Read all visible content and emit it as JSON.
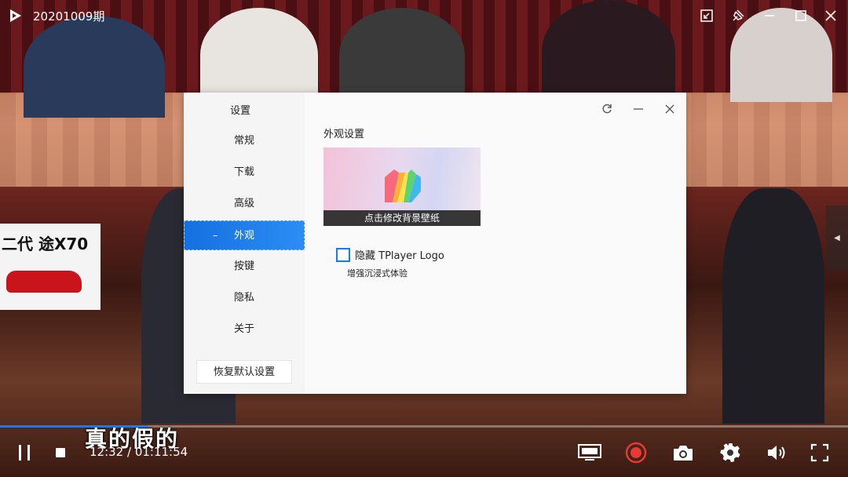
{
  "window": {
    "title": "20201009期"
  },
  "subtitle_overlay": "真的假的",
  "billboard_text": "二代 途X70",
  "settings_dialog": {
    "nav_title": "设置",
    "nav_items": [
      {
        "label": "常规"
      },
      {
        "label": "下载"
      },
      {
        "label": "高级"
      },
      {
        "label": "外观",
        "active": true
      },
      {
        "label": "按键"
      },
      {
        "label": "隐私"
      },
      {
        "label": "关于"
      }
    ],
    "active_marker": "–",
    "reset_label": "恢复默认设置",
    "section_title": "外观设置",
    "wallpaper_caption": "点击修改背景壁纸",
    "hide_logo": {
      "label": "隐藏 TPlayer Logo",
      "checked": false,
      "description": "增强沉浸式体验"
    }
  },
  "player": {
    "time_readout": "12:32 / 01:11:54",
    "progress": 0.1744
  },
  "colors": {
    "accent": "#1a7ae8",
    "record": "#e53935"
  },
  "icons": {
    "logo": "play-logo-icon",
    "restore_page": "refresh-icon"
  }
}
